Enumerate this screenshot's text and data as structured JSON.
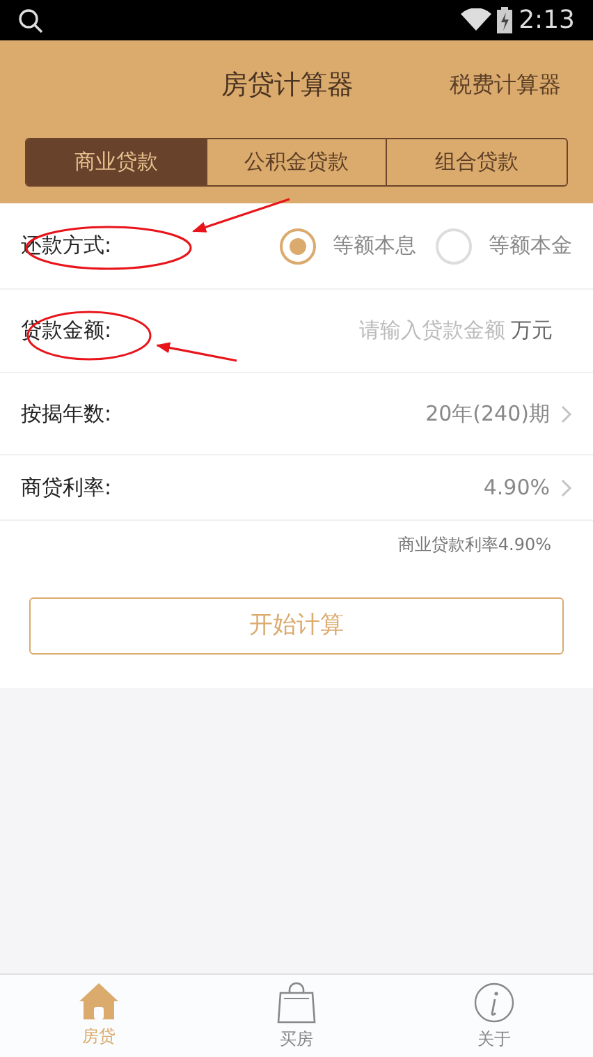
{
  "status_bar": {
    "time": "2:13"
  },
  "header": {
    "title": "房贷计算器",
    "action": "税费计算器"
  },
  "tabs": [
    {
      "label": "商业贷款",
      "selected": true
    },
    {
      "label": "公积金贷款",
      "selected": false
    },
    {
      "label": "组合贷款",
      "selected": false
    }
  ],
  "form": {
    "repayment": {
      "label": "还款方式:",
      "options": [
        {
          "label": "等额本息",
          "selected": true
        },
        {
          "label": "等额本金",
          "selected": false
        }
      ]
    },
    "amount": {
      "label": "贷款金额:",
      "placeholder": "请输入贷款金额",
      "unit": "万元"
    },
    "term": {
      "label": "按揭年数:",
      "value": "20年(240)期"
    },
    "rate": {
      "label": "商贷利率:",
      "value": "4.90%"
    },
    "rate_note": "商业贷款利率4.90%"
  },
  "submit": "开始计算",
  "bottom_nav": [
    {
      "label": "房贷",
      "selected": true
    },
    {
      "label": "买房",
      "selected": false
    },
    {
      "label": "关于",
      "selected": false
    }
  ]
}
